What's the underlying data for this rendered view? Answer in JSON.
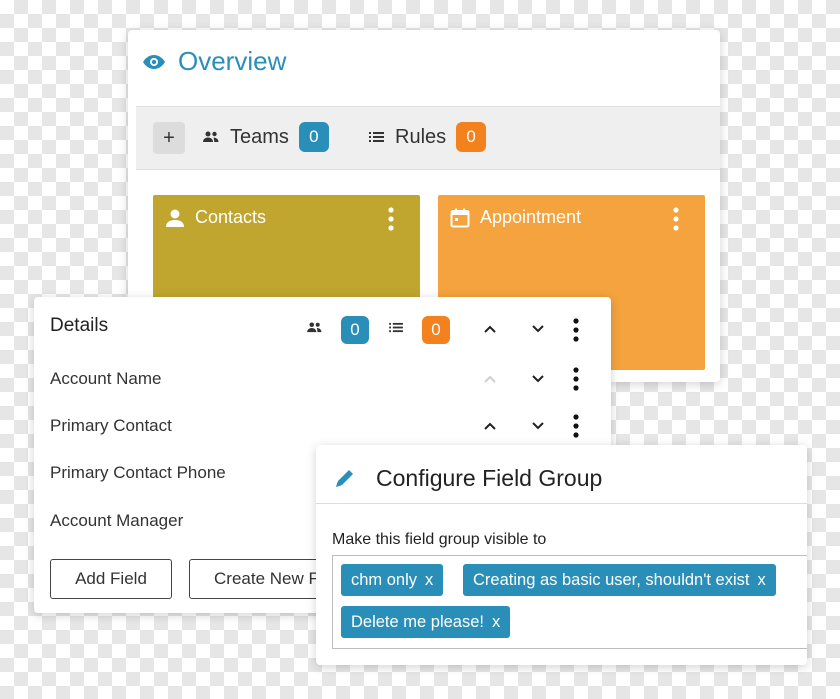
{
  "overview": {
    "title": "Overview",
    "teams_label": "Teams",
    "teams_count": "0",
    "rules_label": "Rules",
    "rules_count": "0",
    "add_label": "+"
  },
  "cards": [
    {
      "label": "Contacts",
      "color": "#c0a52e",
      "icon": "person-icon"
    },
    {
      "label": "Appointment",
      "color": "#f4a33e",
      "icon": "calendar-icon"
    }
  ],
  "details": {
    "title": "Details",
    "teams_count": "0",
    "rules_count": "0",
    "fields": [
      "Account Name",
      "Primary Contact",
      "Primary Contact Phone",
      "Account Manager"
    ],
    "add_field_label": "Add Field",
    "create_new_label": "Create New F"
  },
  "configure": {
    "title": "Configure Field Group",
    "visible_label": "Make this field group visible to",
    "tags": [
      "chm only",
      "Creating as basic user, shouldn't exist",
      "Delete me please!"
    ],
    "tag_close": "x"
  },
  "colors": {
    "blue": "#2a8fb8",
    "orange": "#f2811e",
    "olive": "#c0a52e",
    "light_orange": "#f4a33e"
  }
}
